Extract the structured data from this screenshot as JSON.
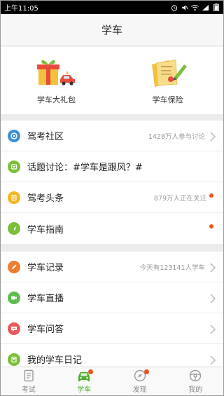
{
  "status_bar": {
    "time": "上午11:05"
  },
  "header": {
    "title": "学车"
  },
  "promo": [
    {
      "label": "学车大礼包",
      "icon": "gift-car-icon"
    },
    {
      "label": "学车保险",
      "icon": "insurance-document-icon"
    }
  ],
  "list1": [
    {
      "label": "驾考社区",
      "meta": "1428万人参与讨论",
      "icon": "community-icon",
      "color": "#3b8fd9",
      "chevron": true,
      "dot": false
    },
    {
      "label": "话题讨论：#学车是跟风？#",
      "meta": "",
      "icon": "topic-icon",
      "color": "#7cbf3b",
      "chevron": false,
      "dot": false
    },
    {
      "label": "驾考头条",
      "meta": "879万人正在关注",
      "icon": "headline-icon",
      "color": "#f2b51e",
      "chevron": false,
      "dot": true
    },
    {
      "label": "学车指南",
      "meta": "",
      "icon": "guide-icon",
      "color": "#7cbf3b",
      "chevron": false,
      "dot": true
    }
  ],
  "list2": [
    {
      "label": "学车记录",
      "meta": "今天有123141人学车",
      "icon": "record-icon",
      "color": "#ef7d2f",
      "chevron": true,
      "dot": false
    },
    {
      "label": "学车直播",
      "meta": "",
      "icon": "live-icon",
      "color": "#5bbf4a",
      "chevron": true,
      "dot": false
    },
    {
      "label": "学车问答",
      "meta": "",
      "icon": "qa-icon",
      "color": "#e85a5a",
      "chevron": true,
      "dot": false
    },
    {
      "label": "我的学车日记",
      "meta": "",
      "icon": "diary-icon",
      "color": "#7cbf3b",
      "chevron": true,
      "dot": false
    }
  ],
  "tabs": [
    {
      "label": "考试",
      "icon": "exam-icon",
      "active": false,
      "badge": false
    },
    {
      "label": "学车",
      "icon": "car-icon",
      "active": true,
      "badge": true
    },
    {
      "label": "发现",
      "icon": "compass-icon",
      "active": false,
      "badge": true
    },
    {
      "label": "我的",
      "icon": "steering-wheel-icon",
      "active": false,
      "badge": false
    }
  ],
  "colors": {
    "accent_green": "#4caf2c",
    "badge_orange": "#e8541e"
  }
}
